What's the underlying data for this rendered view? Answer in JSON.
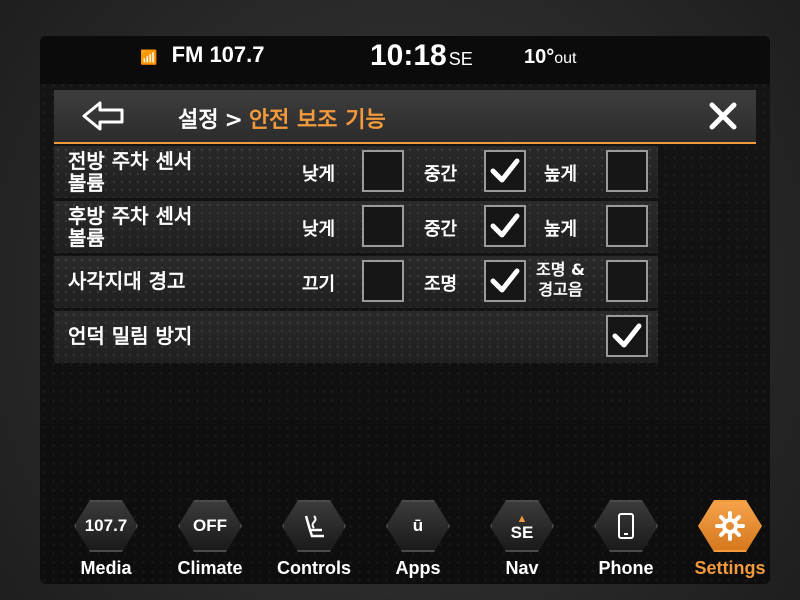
{
  "status": {
    "radio": "FM 107.7",
    "time": "10:18",
    "heading": "SE",
    "temp": "10°",
    "temp_unit": "out"
  },
  "header": {
    "breadcrumb_root": "설정",
    "breadcrumb_sep": ">",
    "breadcrumb_current": "안전 보조 기능",
    "back_icon": "back-arrow-icon",
    "close_icon": "close-icon"
  },
  "settings": [
    {
      "label_line1": "전방 주차 센서",
      "label_line2": "볼륨",
      "options": [
        {
          "label": "낮게",
          "checked": false
        },
        {
          "label": "중간",
          "checked": true
        },
        {
          "label": "높게",
          "checked": false
        }
      ]
    },
    {
      "label_line1": "후방 주차 센서",
      "label_line2": "볼륨",
      "options": [
        {
          "label": "낮게",
          "checked": false
        },
        {
          "label": "중간",
          "checked": true
        },
        {
          "label": "높게",
          "checked": false
        }
      ]
    },
    {
      "label_line1": "사각지대 경고",
      "label_line2": "",
      "options": [
        {
          "label": "끄기",
          "checked": false
        },
        {
          "label": "조명",
          "checked": true
        },
        {
          "label_line1": "조명 &",
          "label_line2": "경고음",
          "checked": false
        }
      ]
    },
    {
      "label_line1": "언덕 밀림 방지",
      "label_line2": "",
      "options": [
        {
          "label": "",
          "checked": true
        }
      ]
    }
  ],
  "nav": [
    {
      "icon_text": "107.7",
      "label": "Media",
      "active": false
    },
    {
      "icon_text": "OFF",
      "label": "Climate",
      "active": false
    },
    {
      "icon_text": "",
      "icon": "seat-controls-icon",
      "label": "Controls",
      "active": false
    },
    {
      "icon_text": "ū",
      "label": "Apps",
      "active": false
    },
    {
      "icon_text": "SE",
      "icon": "compass-icon",
      "label": "Nav",
      "active": false
    },
    {
      "icon_text": "",
      "icon": "phone-icon",
      "label": "Phone",
      "active": false
    },
    {
      "icon_text": "",
      "icon": "gear-icon",
      "label": "Settings",
      "active": true
    }
  ],
  "colors": {
    "accent": "#f39a3c",
    "checked": "#ffffff"
  }
}
